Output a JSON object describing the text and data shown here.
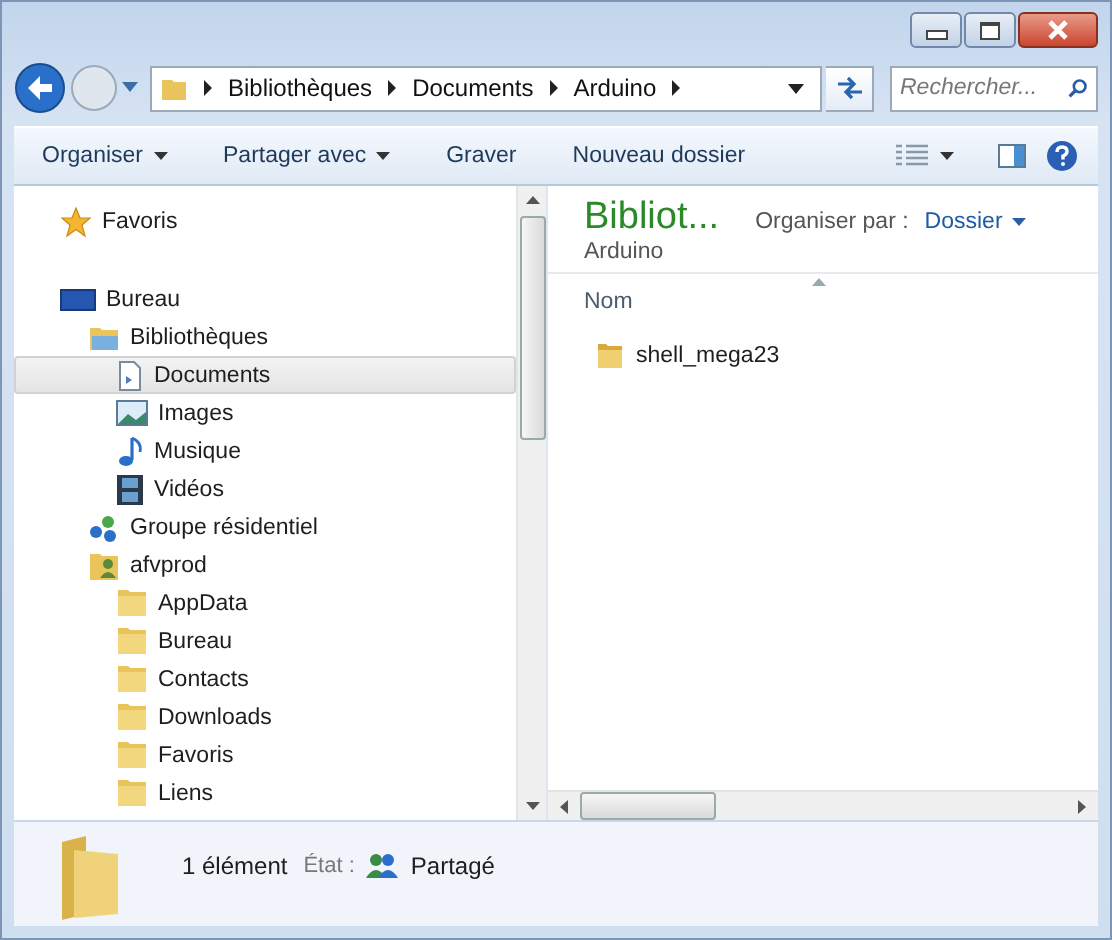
{
  "address_bar": {
    "segments": [
      "Bibliothèques",
      "Documents",
      "Arduino"
    ]
  },
  "search": {
    "placeholder": "Rechercher..."
  },
  "toolbar": {
    "buttons": [
      {
        "label": "Organiser",
        "dropdown": true
      },
      {
        "label": "Partager avec",
        "dropdown": true
      },
      {
        "label": "Graver",
        "dropdown": false
      },
      {
        "label": "Nouveau dossier",
        "dropdown": false
      }
    ]
  },
  "sidebar": {
    "items": [
      {
        "label": "Favoris",
        "kind": "favorites",
        "selected": false
      },
      {
        "label": "Bureau",
        "kind": "desktop",
        "selected": false,
        "children": [
          {
            "label": "Bibliothèques",
            "kind": "library",
            "selected": false,
            "children": [
              {
                "label": "Documents",
                "kind": "document",
                "selected": true
              },
              {
                "label": "Images",
                "kind": "images",
                "selected": false
              },
              {
                "label": "Musique",
                "kind": "music",
                "selected": false
              },
              {
                "label": "Vidéos",
                "kind": "videos",
                "selected": false
              }
            ]
          },
          {
            "label": "Groupe résidentiel",
            "kind": "homegroup",
            "selected": false
          },
          {
            "label": "afvprod",
            "kind": "user",
            "selected": false,
            "children": [
              {
                "label": "AppData",
                "kind": "folder",
                "selected": false
              },
              {
                "label": "Bureau",
                "kind": "folder",
                "selected": false
              },
              {
                "label": "Contacts",
                "kind": "folder",
                "selected": false
              },
              {
                "label": "Downloads",
                "kind": "folder",
                "selected": false
              },
              {
                "label": "Favoris",
                "kind": "folder",
                "selected": false
              },
              {
                "label": "Liens",
                "kind": "folder",
                "selected": false
              }
            ]
          }
        ]
      }
    ]
  },
  "library": {
    "title": "Bibliot...",
    "subtitle": "Arduino",
    "arrange_label": "Organiser par :",
    "arrange_value": "Dossier"
  },
  "file_list": {
    "columns": [
      "Nom"
    ],
    "rows": [
      {
        "name": "shell_mega23"
      }
    ]
  },
  "status_bar": {
    "count": "1 élément",
    "state_label": "État :",
    "state_value": "Partagé"
  }
}
